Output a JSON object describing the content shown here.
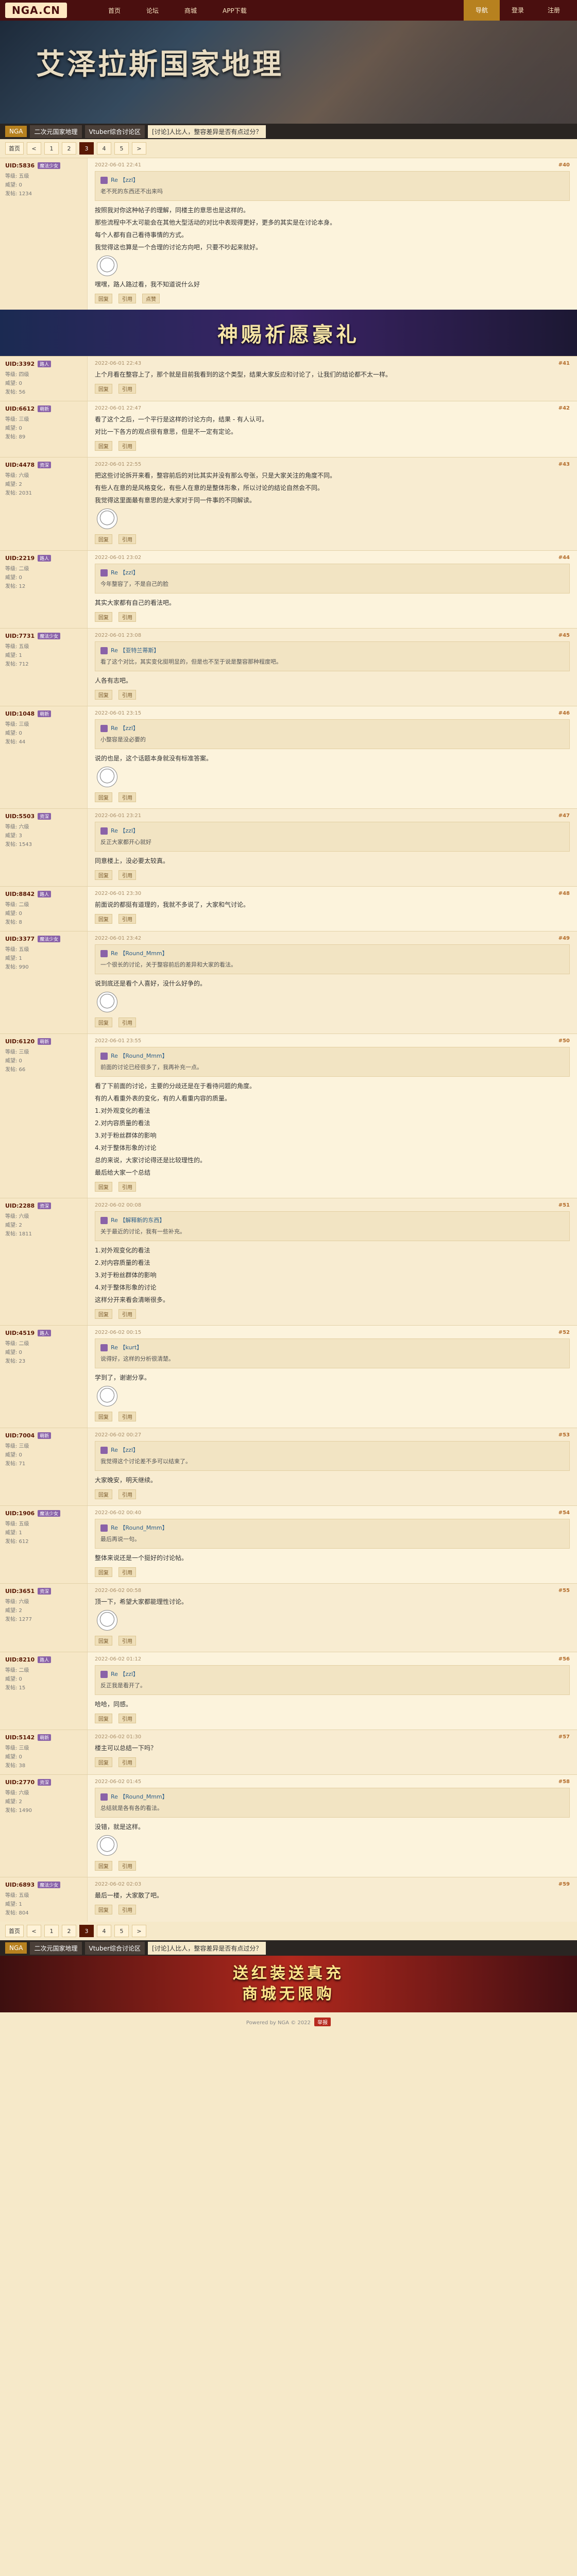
{
  "site": {
    "logo_text": "NGA.CN"
  },
  "topnav": {
    "items": [
      "首页",
      "论坛",
      "商城",
      "APP下载"
    ],
    "right_items": [
      "导航",
      "登录",
      "注册"
    ]
  },
  "banner": {
    "forum_title": "艾泽拉斯国家地理"
  },
  "crumbs": [
    "NGA",
    "二次元国家地理",
    "Vtuber综合讨论区",
    "[讨论]人比人，整容差异是否有点过分？"
  ],
  "pager_top": [
    "首页",
    "<",
    "1",
    "2",
    "3",
    "4",
    "5",
    ">"
  ],
  "pager_bottom": [
    "首页",
    "<",
    "1",
    "2",
    "3",
    "4",
    "5",
    ">"
  ],
  "ad1": {
    "text": "神赐祈愿豪礼"
  },
  "ad2": {
    "text": "送红装送真充\n商城无限购"
  },
  "posts": [
    {
      "uid": "UID:5836",
      "tag": "魔法少女",
      "level": "等级: 五级",
      "prestige": "威望: 0",
      "posts": "发帖: 1234",
      "floor": "#40",
      "time": "2022-06-01 22:41",
      "quote_user": "Re 【zzl】",
      "quote_text": "老不死的东西还不出来吗",
      "body": [
        "按照我对你这种帖子的理解，同楼主的意思也是这样的。",
        "那些流程中不太可能会在其他大型活动的对比中表现得更好，更多的其实是在讨论本身。",
        "每个人都有自己看待事情的方式。",
        "我觉得这也算是一个合理的讨论方向吧，只要不吵起来就好。"
      ],
      "extra": "嘿嘿，路人路过看，我不知道说什么好",
      "actions": [
        "回复",
        "引用",
        "点赞"
      ]
    },
    {
      "uid": "UID:3392",
      "tag": "路人",
      "level": "等级: 四级",
      "prestige": "威望: 0",
      "posts": "发帖: 56",
      "floor": "#41",
      "time": "2022-06-01 22:43",
      "body": [
        "上个月看在整容上了，那个就是目前我看到的这个类型，结果大家反应和讨论了，让我们的结论都不太一样。"
      ],
      "actions": [
        "回复",
        "引用"
      ]
    },
    {
      "uid": "UID:6612",
      "tag": "萌新",
      "level": "等级: 三级",
      "prestige": "威望: 0",
      "posts": "发帖: 89",
      "floor": "#42",
      "time": "2022-06-01 22:47",
      "body": [
        "看了这个之后，一个平行是这样的讨论方向，结果 - 有人认可。",
        "对比一下各方的观点很有意思，但是不一定有定论。"
      ],
      "actions": [
        "回复",
        "引用"
      ]
    },
    {
      "uid": "UID:4478",
      "tag": "资深",
      "level": "等级: 六级",
      "prestige": "威望: 2",
      "posts": "发帖: 2031",
      "floor": "#43",
      "time": "2022-06-01 22:55",
      "body": [
        "把这些讨论拆开来看，整容前后的对比其实并没有那么夸张，只是大家关注的角度不同。",
        "有些人在意的是风格变化，有些人在意的是整体形象，所以讨论的结论自然会不同。",
        "我觉得这里面最有意思的是大家对于同一件事的不同解读。"
      ],
      "actions": [
        "回复",
        "引用"
      ]
    },
    {
      "uid": "UID:2219",
      "tag": "路人",
      "level": "等级: 二级",
      "prestige": "威望: 0",
      "posts": "发帖: 12",
      "floor": "#44",
      "time": "2022-06-01 23:02",
      "quote_user": "Re 【zzl】",
      "quote_text": "今年整容了，不是自己的脸",
      "body": [
        "其实大家都有自己的看法吧。"
      ],
      "actions": [
        "回复",
        "引用"
      ]
    },
    {
      "uid": "UID:7731",
      "tag": "魔法少女",
      "level": "等级: 五级",
      "prestige": "威望: 1",
      "posts": "发帖: 712",
      "floor": "#45",
      "time": "2022-06-01 23:08",
      "quote_user": "Re 【亚特兰蒂斯】",
      "quote_text": "看了这个对比，其实变化挺明显的，但是也不至于说是整容那种程度吧。",
      "body": [
        "人各有志吧。"
      ],
      "actions": [
        "回复",
        "引用"
      ]
    },
    {
      "uid": "UID:1048",
      "tag": "萌新",
      "level": "等级: 三级",
      "prestige": "威望: 0",
      "posts": "发帖: 44",
      "floor": "#46",
      "time": "2022-06-01 23:15",
      "quote_user": "Re 【zzl】",
      "quote_text": "小整容是没必要的",
      "body": [
        "说的也是，这个话题本身就没有标准答案。"
      ],
      "actions": [
        "回复",
        "引用"
      ]
    },
    {
      "uid": "UID:5503",
      "tag": "资深",
      "level": "等级: 六级",
      "prestige": "威望: 3",
      "posts": "发帖: 1543",
      "floor": "#47",
      "time": "2022-06-01 23:21",
      "quote_user": "Re 【zzl】",
      "quote_text": "反正大家都开心就好",
      "body": [
        "同意楼上，没必要太较真。"
      ],
      "actions": [
        "回复",
        "引用"
      ]
    },
    {
      "uid": "UID:8842",
      "tag": "路人",
      "level": "等级: 二级",
      "prestige": "威望: 0",
      "posts": "发帖: 8",
      "floor": "#48",
      "time": "2022-06-01 23:30",
      "body": [
        "前面说的都挺有道理的，我就不多说了，大家和气讨论。"
      ],
      "actions": [
        "回复",
        "引用"
      ]
    },
    {
      "uid": "UID:3377",
      "tag": "魔法少女",
      "level": "等级: 五级",
      "prestige": "威望: 1",
      "posts": "发帖: 990",
      "floor": "#49",
      "time": "2022-06-01 23:42",
      "quote_user": "Re 【Round_Mmm】",
      "quote_text": "一个很长的讨论，关于整容前后的差异和大家的看法。",
      "body": [
        "说到底还是看个人喜好，没什么好争的。"
      ],
      "actions": [
        "回复",
        "引用"
      ]
    },
    {
      "uid": "UID:6120",
      "tag": "萌新",
      "level": "等级: 三级",
      "prestige": "威望: 0",
      "posts": "发帖: 66",
      "floor": "#50",
      "time": "2022-06-01 23:55",
      "quote_user": "Re 【Round_Mmm】",
      "quote_text": "前面的讨论已经很多了，我再补充一点。",
      "body": [
        "看了下前面的讨论，主要的分歧还是在于看待问题的角度。",
        "有的人看重外表的变化，有的人看重内容的质量。",
        "1.对外观变化的看法",
        "2.对内容质量的看法",
        "3.对于粉丝群体的影响",
        "4.对于整体形象的讨论",
        "总的来说，大家讨论得还是比较理性的。"
      ],
      "extra": "最后给大家一个总结",
      "actions": [
        "回复",
        "引用"
      ]
    },
    {
      "uid": "UID:2288",
      "tag": "资深",
      "level": "等级: 六级",
      "prestige": "威望: 2",
      "posts": "发帖: 1811",
      "floor": "#51",
      "time": "2022-06-02 00:08",
      "quote_user": "Re 【解释新的东西】",
      "quote_text": "关于最近的讨论，我有一些补充。",
      "body": [
        "1.对外观变化的看法",
        "2.对内容质量的看法",
        "3.对于粉丝群体的影响",
        "4.对于整体形象的讨论",
        "这样分开来看会清晰很多。"
      ],
      "actions": [
        "回复",
        "引用"
      ]
    },
    {
      "uid": "UID:4519",
      "tag": "路人",
      "level": "等级: 二级",
      "prestige": "威望: 0",
      "posts": "发帖: 23",
      "floor": "#52",
      "time": "2022-06-02 00:15",
      "quote_user": "Re 【kurt】",
      "quote_text": "说得好，这样的分析很清楚。",
      "body": [
        "学到了，谢谢分享。"
      ],
      "actions": [
        "回复",
        "引用"
      ]
    },
    {
      "uid": "UID:7004",
      "tag": "萌新",
      "level": "等级: 三级",
      "prestige": "威望: 0",
      "posts": "发帖: 71",
      "floor": "#53",
      "time": "2022-06-02 00:27",
      "quote_user": "Re 【zzl】",
      "quote_text": "我觉得这个讨论差不多可以结束了。",
      "body": [
        "大家晚安，明天继续。"
      ],
      "actions": [
        "回复",
        "引用"
      ]
    },
    {
      "uid": "UID:1906",
      "tag": "魔法少女",
      "level": "等级: 五级",
      "prestige": "威望: 1",
      "posts": "发帖: 612",
      "floor": "#54",
      "time": "2022-06-02 00:40",
      "quote_user": "Re 【Round_Mmm】",
      "quote_text": "最后再说一句。",
      "body": [
        "整体来说还是一个挺好的讨论帖。"
      ],
      "actions": [
        "回复",
        "引用"
      ]
    },
    {
      "uid": "UID:3651",
      "tag": "资深",
      "level": "等级: 六级",
      "prestige": "威望: 2",
      "posts": "发帖: 1277",
      "floor": "#55",
      "time": "2022-06-02 00:58",
      "body": [
        "顶一下，希望大家都能理性讨论。"
      ],
      "actions": [
        "回复",
        "引用"
      ]
    },
    {
      "uid": "UID:8210",
      "tag": "路人",
      "level": "等级: 二级",
      "prestige": "威望: 0",
      "posts": "发帖: 15",
      "floor": "#56",
      "time": "2022-06-02 01:12",
      "quote_user": "Re 【zzl】",
      "quote_text": "反正我是看开了。",
      "body": [
        "哈哈，同感。"
      ],
      "actions": [
        "回复",
        "引用"
      ]
    },
    {
      "uid": "UID:5142",
      "tag": "萌新",
      "level": "等级: 三级",
      "prestige": "威望: 0",
      "posts": "发帖: 38",
      "floor": "#57",
      "time": "2022-06-02 01:30",
      "body": [
        "楼主可以总结一下吗？"
      ],
      "actions": [
        "回复",
        "引用"
      ]
    },
    {
      "uid": "UID:2770",
      "tag": "资深",
      "level": "等级: 六级",
      "prestige": "威望: 2",
      "posts": "发帖: 1490",
      "floor": "#58",
      "time": "2022-06-02 01:45",
      "quote_user": "Re 【Round_Mmm】",
      "quote_text": "总结就是各有各的看法。",
      "body": [
        "没错，就是这样。"
      ],
      "actions": [
        "回复",
        "引用"
      ]
    },
    {
      "uid": "UID:6893",
      "tag": "魔法少女",
      "level": "等级: 五级",
      "prestige": "威望: 1",
      "posts": "发帖: 804",
      "floor": "#59",
      "time": "2022-06-02 02:03",
      "body": [
        "最后一楼，大家散了吧。"
      ],
      "actions": [
        "回复",
        "引用"
      ]
    }
  ],
  "footer": {
    "text": "Powered by NGA  © 2022  ",
    "button": "举报"
  }
}
